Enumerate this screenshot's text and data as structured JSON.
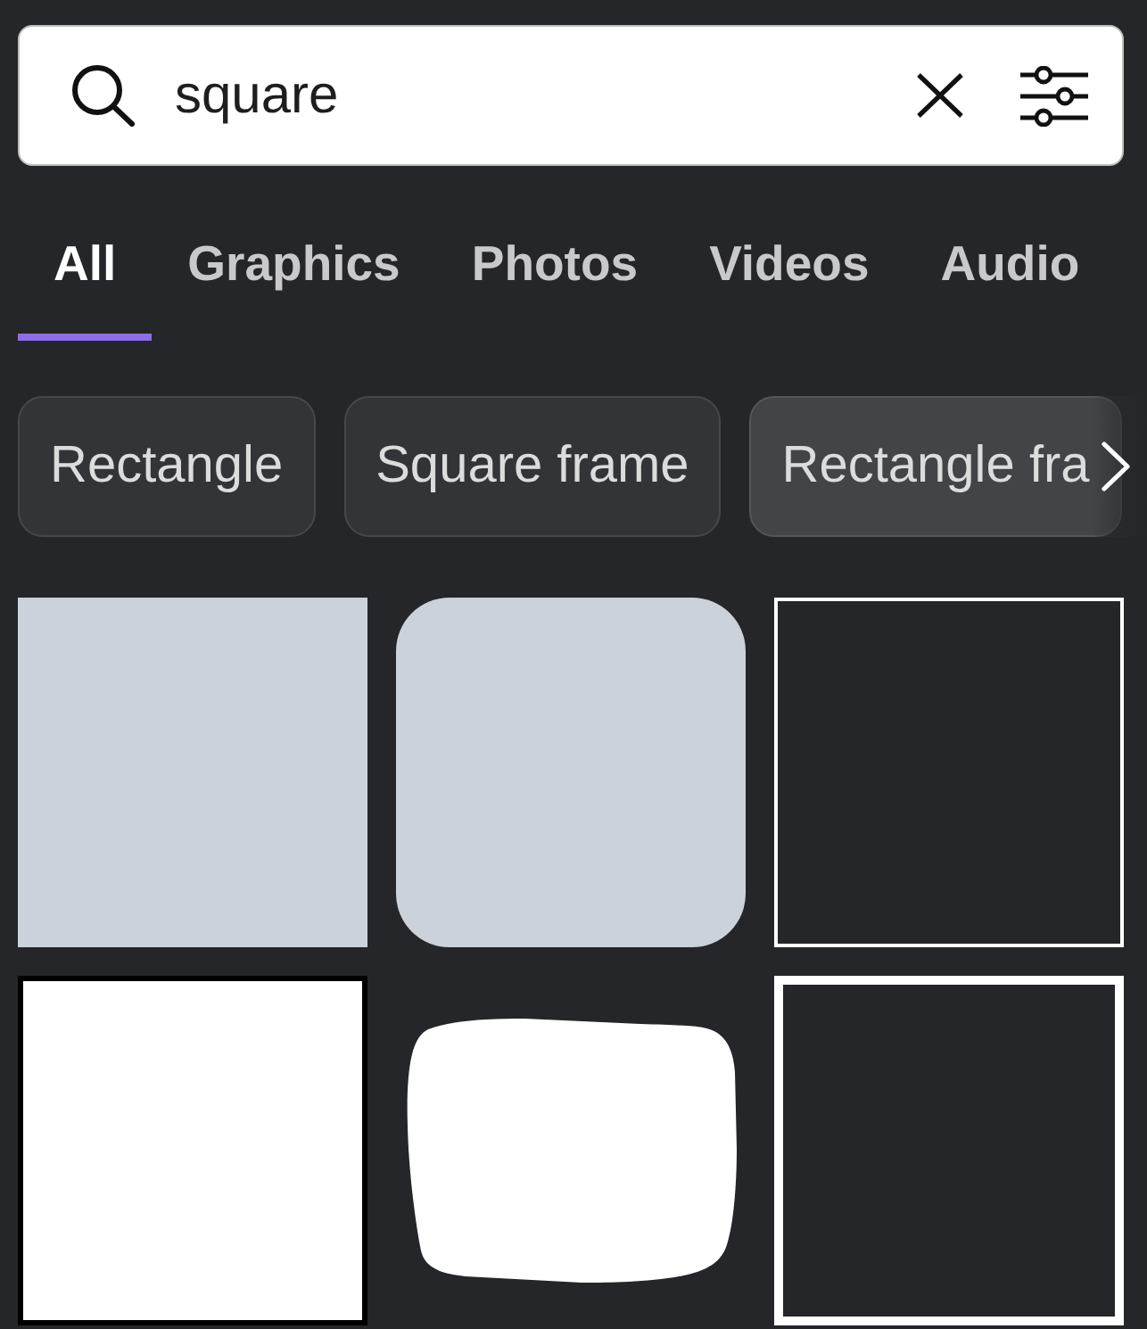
{
  "search": {
    "value": "square"
  },
  "tabs": [
    {
      "label": "All",
      "selected": true
    },
    {
      "label": "Graphics",
      "selected": false
    },
    {
      "label": "Photos",
      "selected": false
    },
    {
      "label": "Videos",
      "selected": false
    },
    {
      "label": "Audio",
      "selected": false
    }
  ],
  "suggestions": [
    {
      "label": "Rectangle",
      "hovered": false
    },
    {
      "label": "Square frame",
      "hovered": false
    },
    {
      "label": "Rectangle fra",
      "hovered": true
    }
  ],
  "results": [
    {
      "kind": "filled-square"
    },
    {
      "kind": "rounded-square"
    },
    {
      "kind": "thin-frame"
    },
    {
      "kind": "bordered-square"
    },
    {
      "kind": "blob"
    },
    {
      "kind": "thick-frame"
    }
  ]
}
